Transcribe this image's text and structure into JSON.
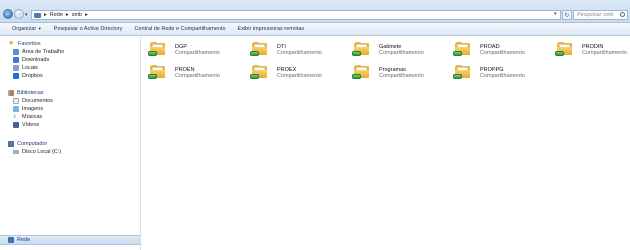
{
  "address": {
    "path": [
      "Rede",
      "smb"
    ],
    "search_placeholder": "Pesquisar smb"
  },
  "toolbar": {
    "organize": "Organizar",
    "search_ad": "Pesquisar o Active Directory",
    "network_center": "Central de Rede e Compartilhamento",
    "remote_printers": "Exibir impressoras remotas"
  },
  "sidebar": {
    "favorites": "Favoritos",
    "fav_items": [
      "Área de Trabalho",
      "Downloads",
      "Locais",
      "Dropbox"
    ],
    "libraries": "Bibliotecas",
    "lib_items": [
      "Documentos",
      "Imagens",
      "Músicas",
      "Vídeos"
    ],
    "computer": "Computador",
    "computer_items": [
      "Disco Local (C:)"
    ],
    "network": "Rede"
  },
  "folders": [
    {
      "name": "DGP",
      "type": "Compartilhamento"
    },
    {
      "name": "DTI",
      "type": "Compartilhamento"
    },
    {
      "name": "Gabinete",
      "type": "Compartilhamento"
    },
    {
      "name": "PROAD",
      "type": "Compartilhamento"
    },
    {
      "name": "PRODIN",
      "type": "Compartilhamento"
    },
    {
      "name": "PROEN",
      "type": "Compartilhamento"
    },
    {
      "name": "PROEX",
      "type": "Compartilhamento"
    },
    {
      "name": "Programas",
      "type": "Compartilhamento"
    },
    {
      "name": "PROPPG",
      "type": "Compartilhamento"
    }
  ]
}
